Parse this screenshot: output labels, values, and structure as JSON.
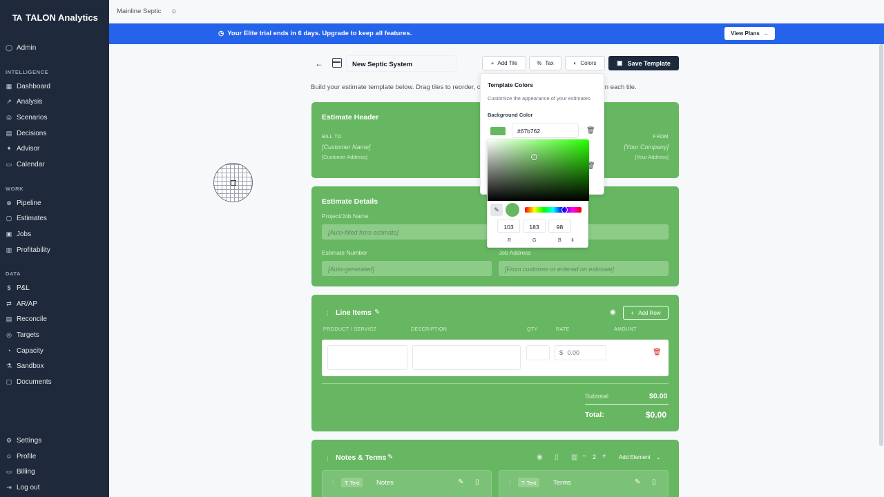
{
  "brand": {
    "logo": "TA",
    "name": "TALON Analytics"
  },
  "sidebar": {
    "admin": "Admin",
    "intelligence_heading": "INTELLIGENCE",
    "intelligence": [
      "Dashboard",
      "Analysis",
      "Scenarios",
      "Decisions",
      "Advisor",
      "Calendar"
    ],
    "work_heading": "WORK",
    "work": [
      "Pipeline",
      "Estimates",
      "Jobs",
      "Profitability"
    ],
    "data_heading": "DATA",
    "data": [
      "P&L",
      "AR/AP",
      "Reconcile",
      "Targets",
      "Capacity",
      "Sandbox",
      "Documents"
    ],
    "bottom": [
      "Settings",
      "Profile",
      "Billing",
      "Log out"
    ]
  },
  "topbar": {
    "company": "Mainline Septic"
  },
  "trial": {
    "message": "Your Elite trial ends in 6 days. Upgrade to keep all features.",
    "button": "View Plans"
  },
  "toolbar": {
    "template_name": "New Septic System",
    "add_tile": "Add Tile",
    "tax": "Tax",
    "colors": "Colors",
    "save": "Save Template"
  },
  "intro": {
    "left": "Build your estimate template below. Drag tiles to reorder, cl",
    "right": "in each tile."
  },
  "header_tile": {
    "title": "Estimate Header",
    "bill_to": "BILL TO",
    "customer_name": "[Customer Name]",
    "customer_address": "[Customer Address]",
    "from": "FROM",
    "your_company": "[Your Company]",
    "your_address": "[Your Address]"
  },
  "details_tile": {
    "title": "Estimate Details",
    "project_label": "Project/Job Name",
    "project_placeholder": "[Auto-filled from estimate]",
    "number_label": "Estimate Number",
    "number_placeholder": "[Auto-generated]",
    "address_label": "Job Address",
    "address_placeholder": "[From customer or entered on estimate]"
  },
  "line_items": {
    "title": "Line Items",
    "add_row": "Add Row",
    "columns": [
      "PRODUCT / SERVICE",
      "DESCRIPTION",
      "QTY",
      "RATE",
      "AMOUNT"
    ],
    "rate_prefix": "$",
    "rate_placeholder": "0.00",
    "subtotal_label": "Subtotal:",
    "subtotal_value": "$0.00",
    "total_label": "Total:",
    "total_value": "$0.00"
  },
  "notes_tile": {
    "title": "Notes & Terms",
    "columns_count": "2",
    "add_element": "Add Element",
    "sub_tiles": [
      {
        "chip": "Text",
        "label": "Notes"
      },
      {
        "chip": "Text",
        "label": "Terms"
      }
    ]
  },
  "colors_popover": {
    "title": "Template Colors",
    "subtitle": "Customize the appearance of your estimates",
    "bg_label": "Background Color",
    "bg_hex": "#67b762",
    "swatch_color": "#67b762",
    "rgb": {
      "r": "103",
      "g": "183",
      "b": "98"
    },
    "rgb_labels": {
      "r": "R",
      "g": "G",
      "b": "B"
    }
  }
}
